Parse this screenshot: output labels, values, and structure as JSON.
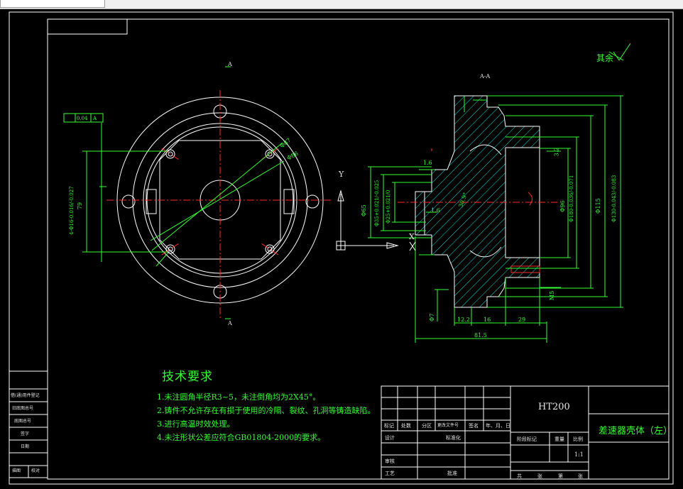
{
  "colors": {
    "background": "#000000",
    "outline": "#ffffff",
    "dimension": "#33ff33",
    "centerline": "#ff2a2a",
    "hatch": "#00e5e5",
    "axis": "#ffffff"
  },
  "view_label_top": "A",
  "view_label_bottom": "A",
  "section_label": "A-A",
  "roughness_note": "其余",
  "tolerance_frame": [
    "",
    "0.04",
    "A"
  ],
  "dims": {
    "d87": "Φ87",
    "d86": "Φ86",
    "width79": "79",
    "holes": "4-Φ16-0.016/-0.027",
    "d65": "Φ65",
    "d35": "Φ35+0.021/-0.025",
    "d25": "Φ25+0.021/0",
    "d96": "Φ96",
    "d180": "Φ180-0.036/-0.071",
    "d115": "Φ115",
    "d130": "Φ130-0.043/-0.083",
    "d7": "Φ7",
    "m5": "M5",
    "l12": "12.2",
    "l16": "16",
    "l29": "29",
    "l815": "81.5",
    "r16a": "1.6",
    "r16b": "1.6",
    "r32": "3.2",
    "ang": "30.9°"
  },
  "axis": {
    "y": "Y",
    "x": "X"
  },
  "tech": {
    "title": "技术要求",
    "items": [
      "1.未注圆角半径R3~5，未注倒角均为2X45°。",
      "2.铸件不允许存在有损于使用的冷隔、裂纹、孔洞等铸造缺陷。",
      "3.进行高温时效处理。",
      "4.未注形状公差应符合GB01804-2000的要求。"
    ]
  },
  "left_strip": [
    "借(通)用件登记",
    "旧底图总号",
    "底图总号",
    "签字",
    "日期"
  ],
  "left_strip_bottom": [
    "描图",
    "校对"
  ],
  "title_block": {
    "material": "HT200",
    "part_name": "差速器壳体（左）",
    "scale": "1:1",
    "header_cells": [
      "标记",
      "处数",
      "分区",
      "更改文件号",
      "签名",
      "年、月、日"
    ],
    "row_design": [
      "设计",
      "标准化"
    ],
    "stage_cells": [
      "阶段标记",
      "重量",
      "比例"
    ],
    "row_review": "审核",
    "row_process": [
      "工艺",
      "批准"
    ],
    "sheet_cells": [
      "共",
      "张",
      "第",
      "张"
    ]
  }
}
